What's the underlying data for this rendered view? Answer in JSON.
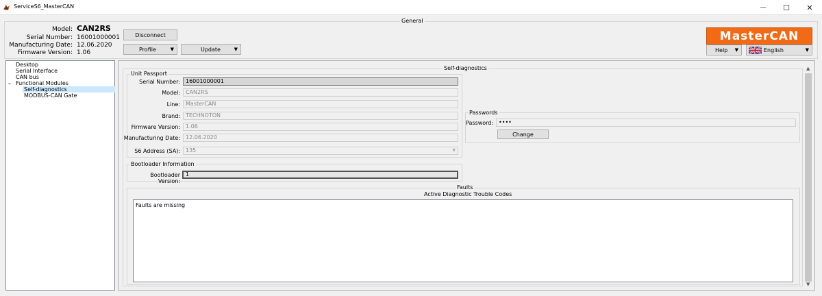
{
  "window": {
    "title": "ServiceS6_MasterCAN",
    "minimize_glyph": "—",
    "maximize_glyph": "☐",
    "close_glyph": "✕"
  },
  "general": {
    "title": "General",
    "model_label": "Model:",
    "model_value": "CAN2RS",
    "serial_label": "Serial Number:",
    "serial_value": "16001000001",
    "mfg_label": "Manufacturing Date:",
    "mfg_value": "12.06.2020",
    "fw_label": "Firmware Version:",
    "fw_value": "1.06",
    "disconnect_label": "Disconnect",
    "profile_label": "Profile",
    "update_label": "Update",
    "help_label": "Help",
    "language_label": "English",
    "logo_text": "MasterCAN"
  },
  "tree": {
    "items": [
      {
        "label": "Desktop"
      },
      {
        "label": "Serial Interface"
      },
      {
        "label": "CAN bus"
      },
      {
        "label": "Functional Modules"
      },
      {
        "label": "Self-diagnostics"
      },
      {
        "label": "MODBUS-CAN Gate"
      }
    ]
  },
  "selfdiag": {
    "title": "Self-diagnostics",
    "passport": {
      "title": "Unit Passport",
      "serial_label": "Serial Number:",
      "serial_value": "16001000001",
      "model_label": "Model:",
      "model_value": "CAN2RS",
      "line_label": "Line:",
      "line_value": "MasterCAN",
      "brand_label": "Brand:",
      "brand_value": "TECHNOTON",
      "fw_label": "Firmware Version:",
      "fw_value": "1.06",
      "mfg_label": "Manufacturing Date:",
      "mfg_value": "12.06.2020",
      "s6_label": "S6 Address (SA):",
      "s6_value": "135"
    },
    "bootloader": {
      "title": "Bootloader Information",
      "version_label": "Bootloader Version:",
      "version_value": "1"
    },
    "passwords": {
      "title": "Passwords",
      "password_label": "Password:",
      "password_value": "••••",
      "change_label": "Change"
    },
    "faults": {
      "title": "Faults",
      "dtc_title": "Active Diagnostic Trouble Codes",
      "message": "Faults are missing"
    }
  },
  "colors": {
    "logo_bg": "#f26a16",
    "selection": "#cce8ff"
  }
}
